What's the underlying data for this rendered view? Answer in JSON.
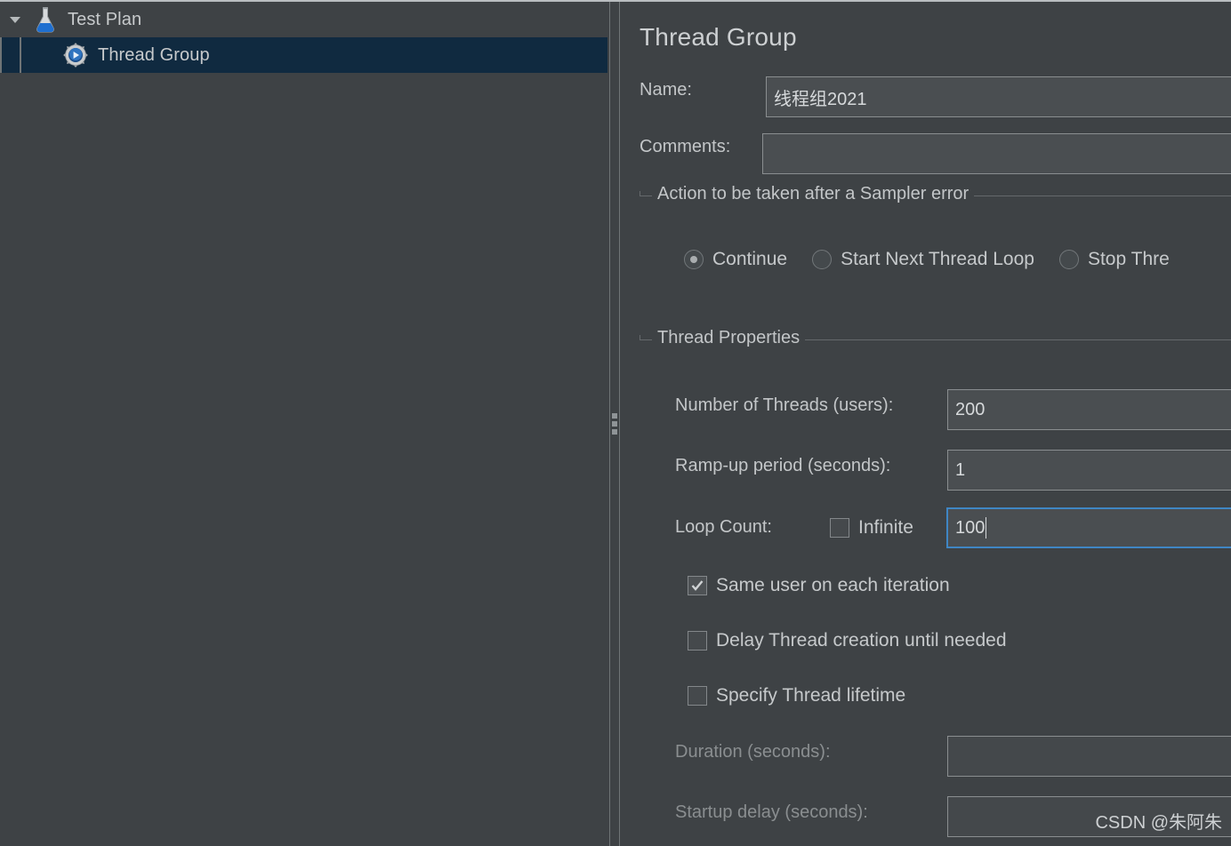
{
  "tree": {
    "nodes": [
      {
        "label": "Test Plan",
        "icon": "test-plan-flask-icon",
        "expanded": true,
        "selected": false,
        "depth": 0
      },
      {
        "label": "Thread Group",
        "icon": "thread-group-gear-icon",
        "expanded": false,
        "selected": true,
        "depth": 1
      }
    ]
  },
  "detail": {
    "title": "Thread Group",
    "name_label": "Name:",
    "name_value": "线程组2021",
    "comments_label": "Comments:",
    "comments_value": "",
    "sampler_error": {
      "legend": "Action to be taken after a Sampler error",
      "options": [
        {
          "label": "Continue",
          "selected": true
        },
        {
          "label": "Start Next Thread Loop",
          "selected": false
        },
        {
          "label": "Stop Thre",
          "selected": false
        }
      ]
    },
    "thread_properties": {
      "legend": "Thread Properties",
      "num_threads_label": "Number of Threads (users):",
      "num_threads_value": "200",
      "ramp_up_label": "Ramp-up period (seconds):",
      "ramp_up_value": "1",
      "loop_count_label": "Loop Count:",
      "infinite_label": "Infinite",
      "infinite_checked": false,
      "loop_count_value": "100",
      "loop_count_focused": true,
      "checkboxes": [
        {
          "label": "Same user on each iteration",
          "checked": true
        },
        {
          "label": "Delay Thread creation until needed",
          "checked": false
        },
        {
          "label": "Specify Thread lifetime",
          "checked": false
        }
      ],
      "duration_label": "Duration (seconds):",
      "duration_value": "",
      "duration_disabled": true,
      "startup_delay_label": "Startup delay (seconds):",
      "startup_delay_value": "",
      "startup_delay_disabled": true
    }
  },
  "watermark": "CSDN @朱阿朱",
  "colors": {
    "background": "#3e4245",
    "selection": "#102a40",
    "focus_border": "#3f86c4",
    "field_background": "#4a4e51",
    "text": "#c6c9cb",
    "text_disabled": "#8a8e90"
  }
}
